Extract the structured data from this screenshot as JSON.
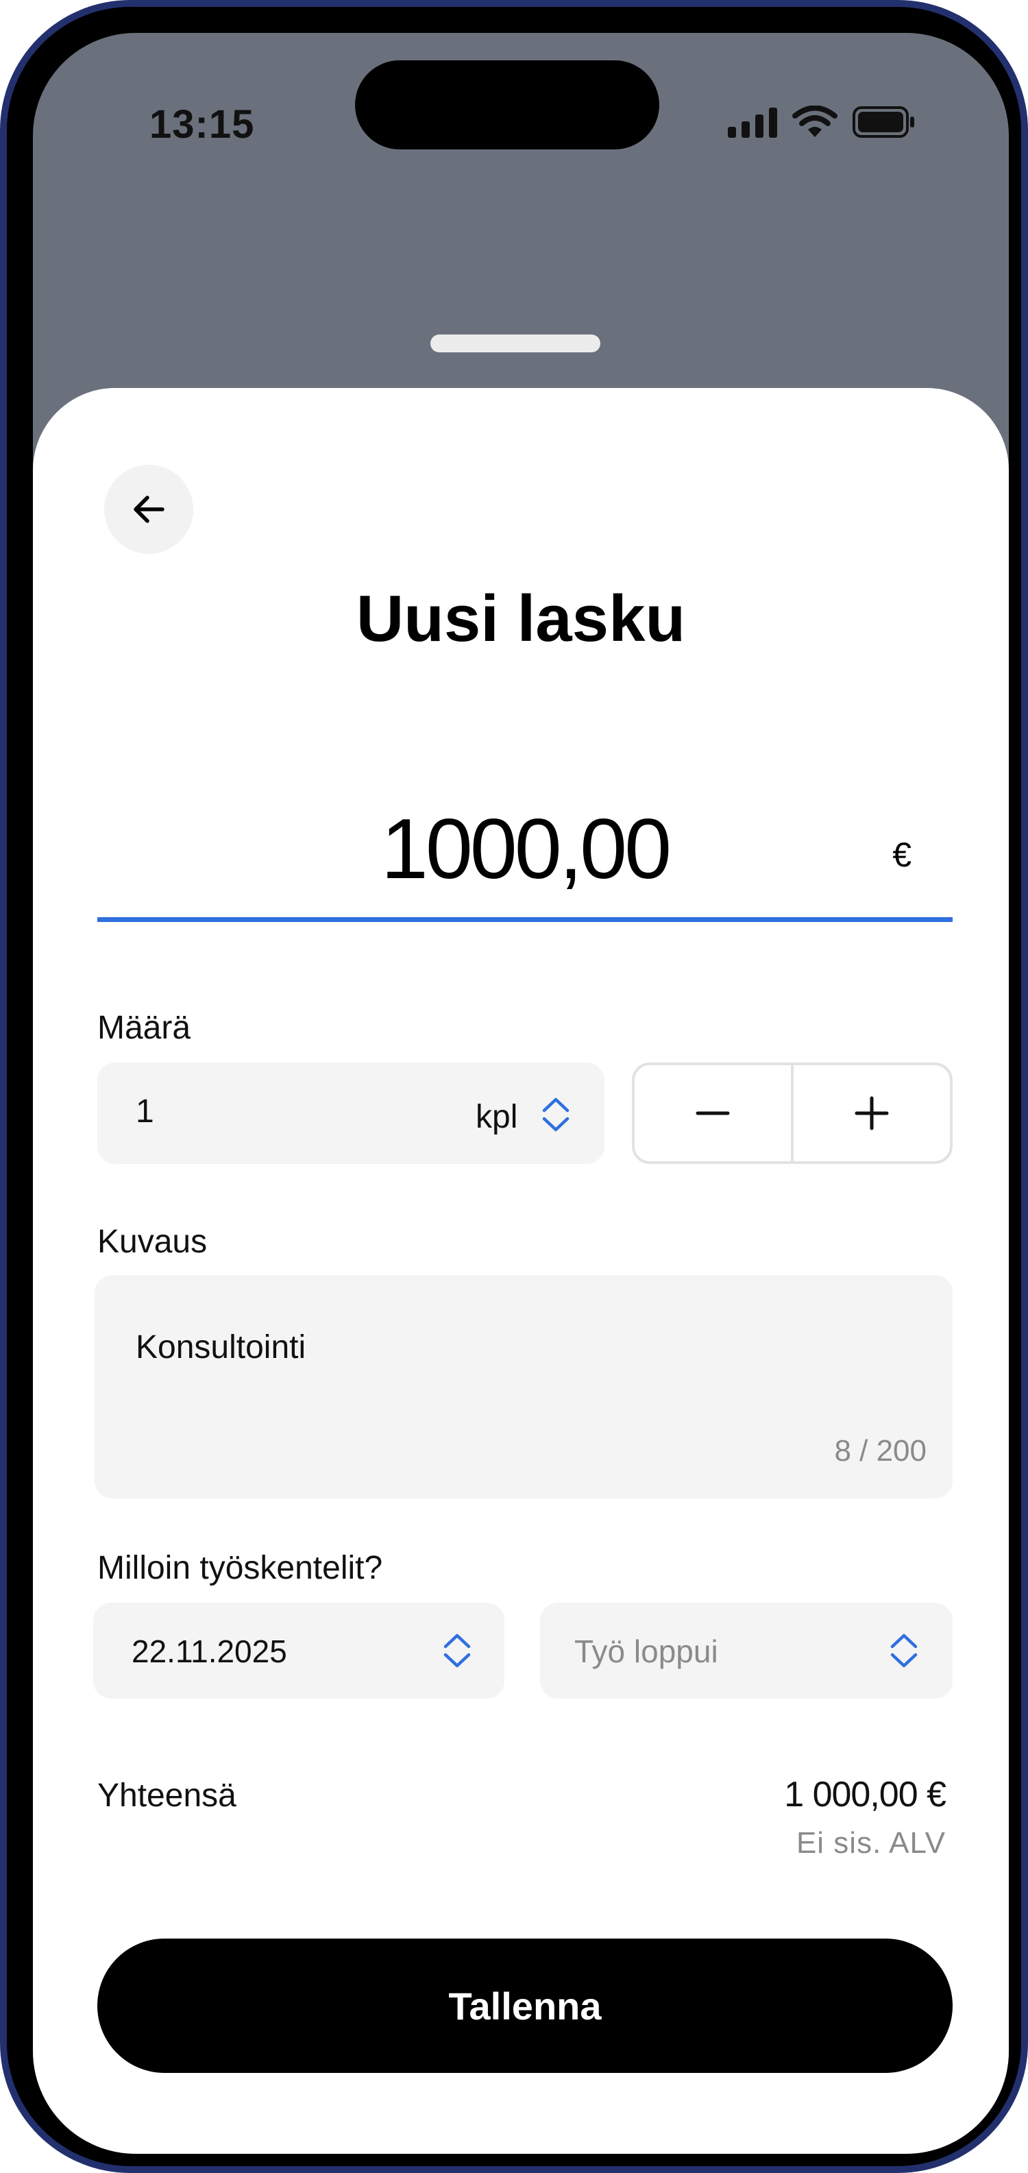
{
  "status_bar": {
    "time": "13:15",
    "icons": [
      "cellular-signal-icon",
      "wifi-icon",
      "battery-icon"
    ]
  },
  "header": {
    "back_icon": "arrow-left-icon",
    "title": "Uusi lasku"
  },
  "amount": {
    "value": "1000,00",
    "currency": "€"
  },
  "quantity": {
    "label": "Määrä",
    "value": "1",
    "unit": "kpl",
    "decrement_icon": "minus-icon",
    "increment_icon": "plus-icon"
  },
  "description": {
    "label": "Kuvaus",
    "value": "Konsultointi",
    "counter": "8 / 200"
  },
  "work_dates": {
    "label": "Milloin työskentelit?",
    "start_value": "22.11.2025",
    "end_placeholder": "Työ loppui"
  },
  "total": {
    "label": "Yhteensä",
    "value": "1 000,00 €",
    "note": "Ei sis. ALV"
  },
  "actions": {
    "save_label": "Tallenna"
  },
  "colors": {
    "accent": "#2f6fde",
    "frame": "#23306e",
    "backdrop": "#6b717c",
    "field_bg": "#f4f4f4",
    "button_bg": "#000000"
  }
}
